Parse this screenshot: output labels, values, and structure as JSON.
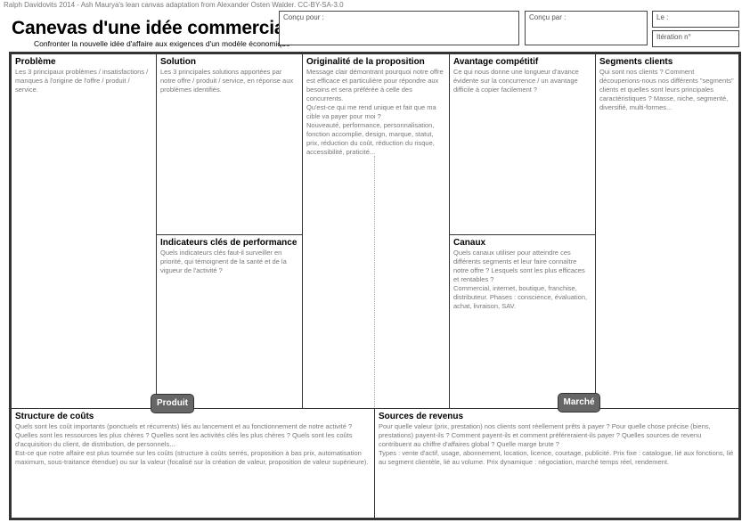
{
  "header": {
    "credit": "Ralph Davidovits 2014 - Ash Maurya's lean canvas adaptation from Alexander Osten Walder. CC-BY-SA-3.0",
    "title": "Canevas d'une idée commerciale",
    "subtitle": "Confronter la nouvelle idée d'affaire aux exigences d'un modèle économique"
  },
  "fields": {
    "concu_pour": "Conçu pour :",
    "concu_par": "Conçu par :",
    "le": "Le :",
    "iteration": "Itération n°"
  },
  "blocks": {
    "probleme": {
      "title": "Problème",
      "text": "Les 3 principaux problèmes / insatisfactions / manques à l'origine de l'offre / produit / service."
    },
    "solution": {
      "title": "Solution",
      "text": "Les 3 principales solutions apportées par notre offre / produit / service, en réponse aux problèmes identifiés."
    },
    "indicateurs": {
      "title": "Indicateurs clés de performance",
      "text": "Quels indicateurs clés faut-il surveiller en priorité, qui témoignent de la santé et de la vigueur de l'activité ?"
    },
    "originalite": {
      "title": "Originalité de la proposition",
      "text": "Message clair démontrant pourquoi notre offre est efficace et particulière pour répondre aux besoins et sera préférée à celle des concurrents.\nQu'est-ce qui me rend unique et fait que ma cible va payer pour moi ?\nNouveauté, performance, personnalisation, fonction accomplie, design, marque, statut, prix, réduction du coût, réduction du risque, accessibilité, praticité..."
    },
    "avantage": {
      "title": "Avantage compétitif",
      "text": "Ce qui nous donne une longueur d'avance évidente sur la concurrence / un avantage difficile à copier facilement ?"
    },
    "canaux": {
      "title": "Canaux",
      "text": "Quels canaux utiliser pour atteindre ces différents segments et leur faire connaître notre offre ? Lesquels sont les plus efficaces et rentables ?\nCommercial, internet, boutique, franchise, distributeur. Phases : conscience,  évaluation, achat, livraison, SAV."
    },
    "segments": {
      "title": "Segments clients",
      "text": "Qui sont nos clients ? Comment découperions-nous nos différents \"segments\" clients et quelles sont leurs principales caractéristiques ? Masse, niche, segmenté, diversifié, multi-formes..."
    },
    "couts": {
      "title": "Structure de coûts",
      "text": "Quels sont les coût importants (ponctuels et récurrents) liés au lancement et au fonctionnement de notre activité ?\nQuelles sont les ressources les plus chères ? Quelles sont les activités clés les plus chères ? Quels sont les coûts d'acquisition du client, de distribution, de personnels...\nEst-ce que notre affaire est plus tournée sur les coûts (structure à coûts serrés, proposition à bas prix, automatisation maximum, sous-traitance étendue) ou sur la valeur (focalisé sur la création de valeur, proposition de valeur supérieure)."
    },
    "revenus": {
      "title": "Sources de revenus",
      "text": "Pour quelle valeur (prix, prestation) nos clients sont réellement prêts à payer ? Pour quelle chose précise (biens, prestations) payent-ils ? Comment payent-ils et comment préféreraient-ils payer ? Quelles sources de revenu contribuent au chiffre d'affaires global ? Quelle marge brute ?\nTypes : vente d'actif, usage, abonnement, location, licence, courtage, publicité. Prix fixe : catalogue, lié aux fonctions, lié au segment clientèle, lié au volume. Prix dynamique : négociation, marché temps réel, rendement."
    }
  },
  "badges": {
    "produit": "Produit",
    "marche": "Marché"
  }
}
